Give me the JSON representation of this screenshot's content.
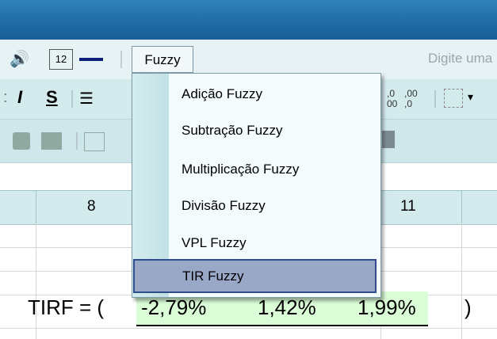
{
  "menu": {
    "fuzzy_label": "Fuzzy",
    "search_placeholder": "Digite uma"
  },
  "dropdown": {
    "items": [
      "Adição Fuzzy",
      "Subtração Fuzzy",
      "Multiplicação Fuzzy",
      "Divisão Fuzzy",
      "VPL Fuzzy",
      "TIR Fuzzy"
    ],
    "selected": "TIR Fuzzy"
  },
  "toolbar": {
    "italic": "I",
    "underline": "S",
    "inc_decimal": "←,0\n,00",
    "dec_decimal": ",00\n→,0"
  },
  "column_headers": [
    "8",
    "11"
  ],
  "formula": {
    "label": "TIRF = (",
    "values": [
      "-2,79%",
      "1,42%",
      "1,99%"
    ],
    "close": ")"
  }
}
